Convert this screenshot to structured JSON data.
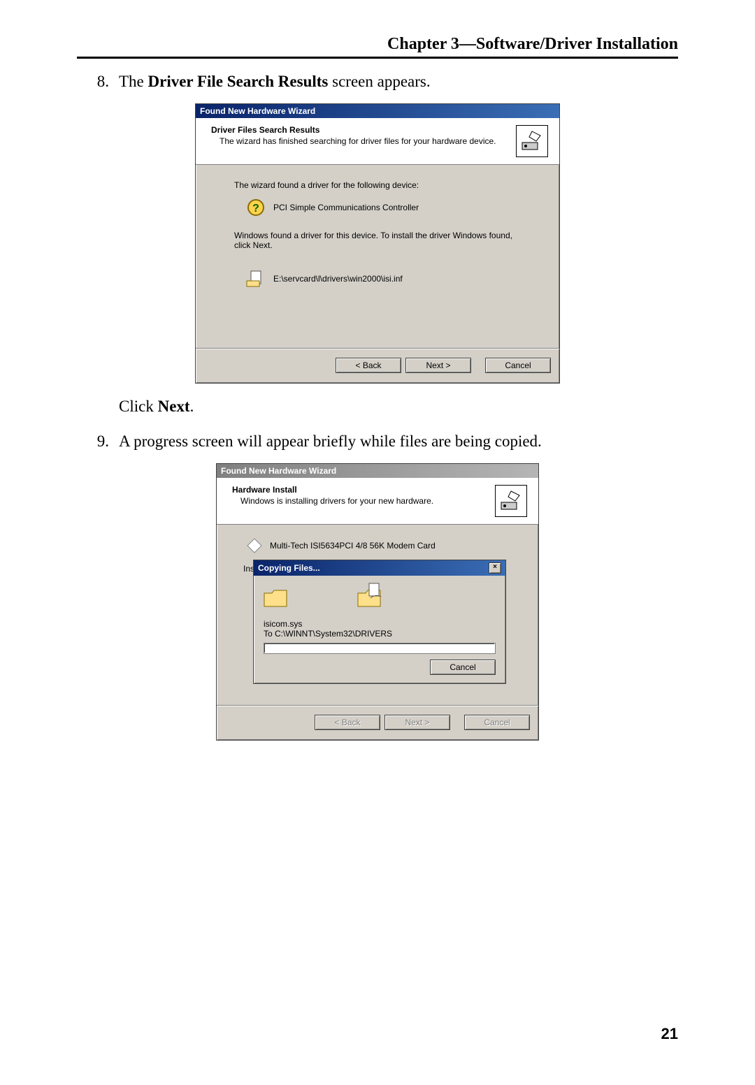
{
  "chapter_heading": "Chapter 3—Software/Driver Installation",
  "step8": {
    "num": "8.",
    "text_a": "The ",
    "bold": "Driver File Search Results",
    "text_b": " screen appears."
  },
  "click_line": {
    "a": "Click ",
    "b": "Next",
    "c": "."
  },
  "step9": {
    "num": "9.",
    "text": "A progress screen will appear briefly while files are being copied."
  },
  "wiz1": {
    "title": "Found New Hardware Wizard",
    "h_title": "Driver Files Search Results",
    "h_sub": "The wizard has finished searching for driver files for your hardware device.",
    "line1": "The wizard found a driver for the following device:",
    "device": "PCI Simple Communications Controller",
    "line2": "Windows found a driver for this device. To install the driver Windows found, click Next.",
    "inf_path": "E:\\servcard\\l\\drivers\\win2000\\isi.inf",
    "btn_back": "< Back",
    "btn_next": "Next >",
    "btn_cancel": "Cancel"
  },
  "wiz2": {
    "title": "Found New Hardware Wizard",
    "h_title": "Hardware Install",
    "h_sub": "Windows is installing drivers for your new hardware.",
    "device": "Multi-Tech ISI5634PCI 4/8 56K Modem Card",
    "ins_label": "Ins",
    "copy_title": "Copying Files...",
    "copy_file": "isicom.sys",
    "copy_dest": "To C:\\WINNT\\System32\\DRIVERS",
    "copy_cancel": "Cancel",
    "btn_back": "< Back",
    "btn_next": "Next >",
    "btn_cancel": "Cancel",
    "close_x": "×"
  },
  "page_number": "21"
}
